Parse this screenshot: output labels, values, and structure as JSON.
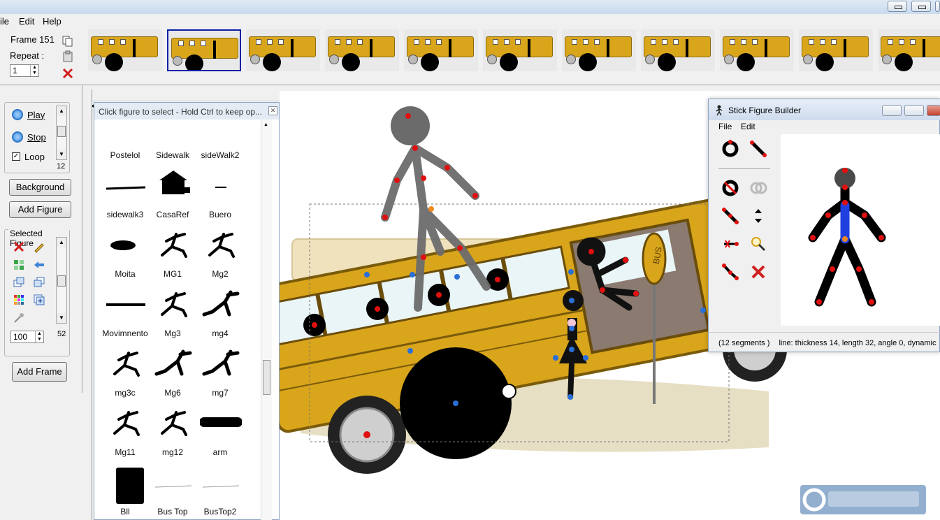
{
  "window": {
    "controls": [
      "minimize",
      "maximize",
      "close"
    ]
  },
  "menubar": {
    "items": [
      "ile",
      "Edit",
      "Help"
    ]
  },
  "frame_panel": {
    "frame_label": "Frame 151",
    "repeat_label": "Repeat :",
    "repeat_value": "1",
    "thumbnail_count": 11,
    "selected_thumbnail": 2
  },
  "playback": {
    "play_label": "Play",
    "stop_label": "Stop",
    "loop_label": "Loop",
    "loop_checked": true,
    "scroll_value": "12"
  },
  "buttons": {
    "background": "Background",
    "add_figure": "Add Figure",
    "add_frame": "Add Frame"
  },
  "selected_figure": {
    "title": "Selected Figure",
    "opacity_value": "100",
    "scroll_value": "52"
  },
  "library": {
    "title": "Click figure to select - Hold Ctrl to keep op...",
    "items": [
      {
        "label": "Postelol",
        "icon": "street-lamp-icon"
      },
      {
        "label": "Sidewalk",
        "icon": "sidewalk-icon"
      },
      {
        "label": "sideWalk2",
        "icon": "sidewalk-icon"
      },
      {
        "label": "sidewalk3",
        "icon": "sidewalk-line-icon"
      },
      {
        "label": "CasaRef",
        "icon": "house-icon"
      },
      {
        "label": "Buero",
        "icon": "dash-icon"
      },
      {
        "label": "Moita",
        "icon": "bush-icon"
      },
      {
        "label": "MG1",
        "icon": "running-figure-icon"
      },
      {
        "label": "Mg2",
        "icon": "running-figure-icon"
      },
      {
        "label": "Movimnento",
        "icon": "line-icon"
      },
      {
        "label": "Mg3",
        "icon": "running-figure-icon"
      },
      {
        "label": "mg4",
        "icon": "crouching-figure-icon"
      },
      {
        "label": "mg3c",
        "icon": "running-figure-icon"
      },
      {
        "label": "Mg6",
        "icon": "crouching-figure-icon"
      },
      {
        "label": "mg7",
        "icon": "crouching-figure-icon"
      },
      {
        "label": "Mg11",
        "icon": "running-figure-icon"
      },
      {
        "label": "mg12",
        "icon": "running-figure-icon"
      },
      {
        "label": "arm",
        "icon": "arm-icon"
      },
      {
        "label": "Bll",
        "icon": "block-icon"
      },
      {
        "label": "Bus Top",
        "icon": "bus-top-icon"
      },
      {
        "label": "BusTop2",
        "icon": "bus-top-icon"
      }
    ]
  },
  "canvas": {
    "scene": "bus",
    "sign_text": "BUS"
  },
  "builder": {
    "title": "Stick Figure Builder",
    "menu": [
      "File",
      "Edit"
    ],
    "tools": [
      "ring-icon",
      "line-segment-icon",
      "no-ring-icon",
      "ghost-circles-icon",
      "segment-icon",
      "up-down-arrows-icon",
      "remove-segment-icon",
      "magnifier-icon",
      "polyline-icon",
      "delete-icon"
    ],
    "status_segments": "(12 segments )",
    "status_info": "line: thickness 14, length 32, angle 0, dynamic"
  },
  "colors": {
    "bus_yellow": "#d9a51b",
    "joint_red": "#e01010",
    "joint_blue": "#2a6fd8",
    "selection_blue": "#0a1ea6"
  }
}
